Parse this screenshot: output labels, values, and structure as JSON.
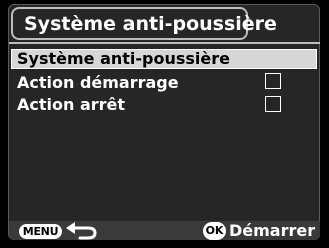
{
  "header": {
    "title": "Système anti-poussière"
  },
  "menu": {
    "items": [
      {
        "label": "Système anti-poussière",
        "selected": true,
        "has_checkbox": false
      },
      {
        "label": "Action démarrage",
        "selected": false,
        "has_checkbox": true,
        "checked": false
      },
      {
        "label": "Action arrêt",
        "selected": false,
        "has_checkbox": true,
        "checked": false
      }
    ]
  },
  "footer": {
    "menu_button_label": "MENU",
    "back_icon": "return-arrow-icon",
    "ok_button_label": "OK",
    "action_label": "Démarrer"
  },
  "colors": {
    "background": "#000000",
    "panel": "#262626",
    "selection": "#d6d6d6",
    "text": "#ffffff"
  }
}
